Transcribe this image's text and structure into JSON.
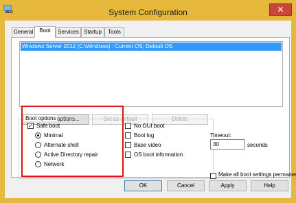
{
  "window": {
    "title": "System Configuration",
    "close_glyph": "✕"
  },
  "tabs": [
    {
      "label": "General",
      "active": false
    },
    {
      "label": "Boot",
      "active": true
    },
    {
      "label": "Services",
      "active": false
    },
    {
      "label": "Startup",
      "active": false
    },
    {
      "label": "Tools",
      "active": false
    }
  ],
  "os_list": {
    "entries": [
      "Windows Server 2012 (C:\\Windows) : Current OS; Default OS"
    ],
    "selected_index": 0
  },
  "list_buttons": {
    "advanced": "Advanced options...",
    "set_default": "Set as default",
    "delete": "Delete"
  },
  "boot_options": {
    "label": "Boot options",
    "safe_boot": {
      "label": "Safe boot",
      "checked": true
    },
    "radios": [
      {
        "label": "Minimal",
        "selected": true
      },
      {
        "label": "Alternate shell",
        "selected": false
      },
      {
        "label": "Active Directory repair",
        "selected": false
      },
      {
        "label": "Network",
        "selected": false
      }
    ],
    "checkboxes": [
      {
        "label": "No GUI boot",
        "checked": false
      },
      {
        "label": "Boot log",
        "checked": false
      },
      {
        "label": "Base video",
        "checked": false
      },
      {
        "label": "OS boot information",
        "checked": false
      }
    ]
  },
  "timeout": {
    "label": "Timeout:",
    "value": "30",
    "unit": "seconds"
  },
  "persist": {
    "label": "Make all boot settings permanent",
    "checked": false
  },
  "dialog_buttons": {
    "ok": "OK",
    "cancel": "Cancel",
    "apply": "Apply",
    "help": "Help"
  },
  "icons": {
    "app": "system-config-icon",
    "close": "close-icon",
    "check": "checkmark-icon"
  },
  "colors": {
    "frame": "#e6b93c",
    "close": "#c9463d",
    "selection": "#3399ff",
    "highlight": "#e0111b"
  }
}
